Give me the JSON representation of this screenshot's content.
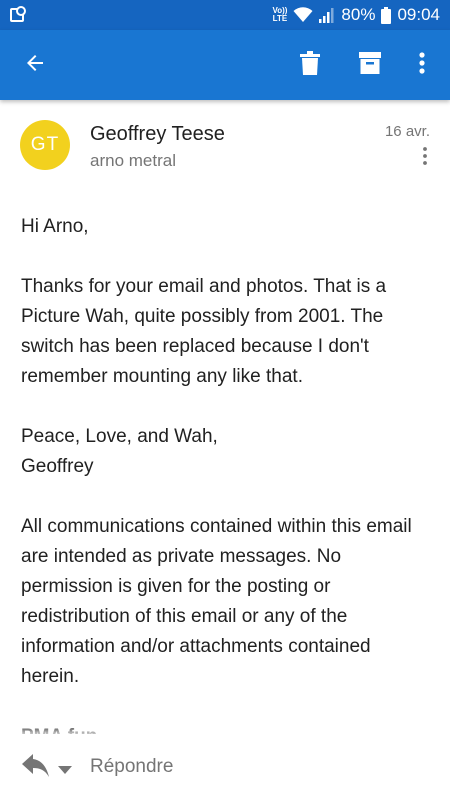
{
  "status_bar": {
    "lte_top": "Vo))",
    "lte_bottom": "LTE",
    "battery_percent": "80%",
    "time": "09:04",
    "icons": [
      "notification-icon",
      "volte-icon",
      "wifi-icon",
      "signal-icon",
      "battery-icon"
    ]
  },
  "app_bar": {
    "icons": [
      "back-arrow-icon",
      "trash-icon",
      "archive-icon",
      "more-vert-icon"
    ],
    "color": "#1976d2"
  },
  "message": {
    "avatar_initials": "GT",
    "avatar_color": "#f2d11e",
    "sender": "Geoffrey Teese",
    "recipient": "arno metral",
    "date": "16 avr.",
    "body": {
      "greeting": "Hi Arno,",
      "paragraph1": "Thanks for your email and photos. That is a Picture Wah, quite possibly from 2001. The switch has been replaced because I don't remember mounting any like that.",
      "signoff_line1": "Peace, Love, and Wah,",
      "signoff_line2": "Geoffrey",
      "disclaimer": "All communications contained within this email are intended as private messages. No permission is given for the posting or redistribution of this email or any of the information and/or attachments contained herein.",
      "cut_line": "PMA fun..."
    }
  },
  "reply_bar": {
    "reply_label": "Répondre",
    "icons": [
      "reply-icon",
      "caret-down-icon"
    ]
  }
}
